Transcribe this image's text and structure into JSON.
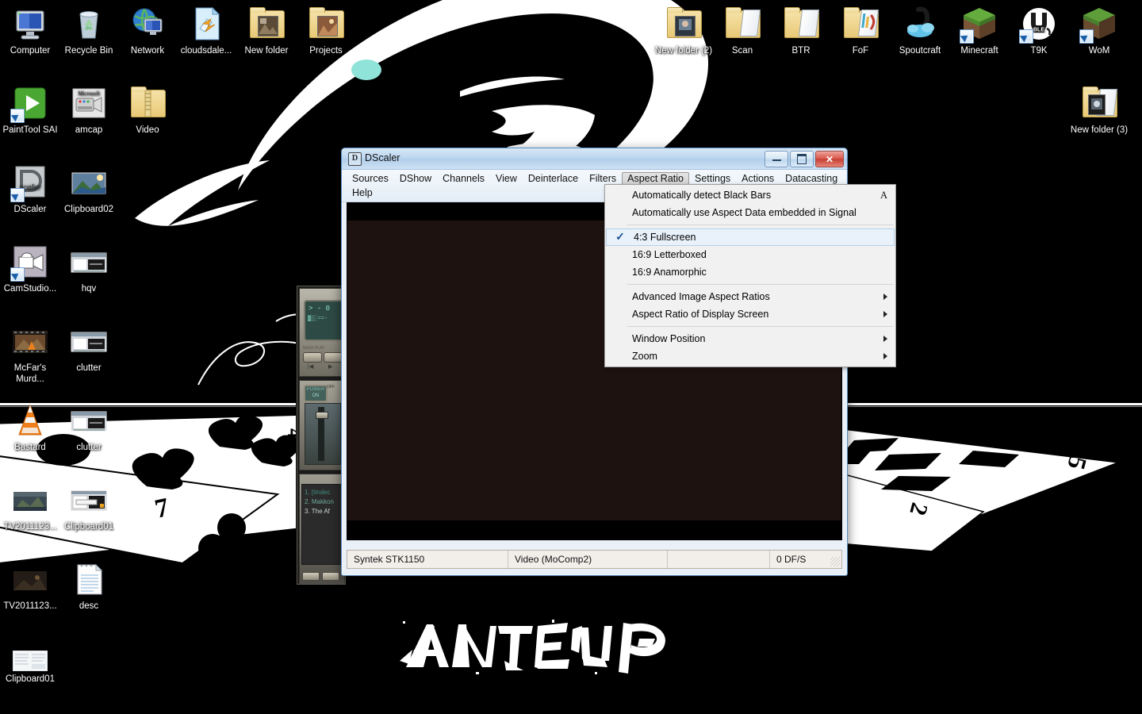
{
  "desktop": {
    "wallpaper_title": "ANTE UP",
    "background_color": "#000000",
    "accent_color": "#8fe3d8",
    "icons_row1": [
      {
        "label": "Computer",
        "icon": "computer-icon",
        "type": "computer"
      },
      {
        "label": "Recycle Bin",
        "icon": "recycle-bin-icon",
        "type": "recycle"
      },
      {
        "label": "Network",
        "icon": "network-icon",
        "type": "network"
      },
      {
        "label": "cloudsdale...",
        "icon": "file-icon",
        "type": "doc"
      },
      {
        "label": "New folder",
        "icon": "folder-icon",
        "type": "folder-pic"
      },
      {
        "label": "Projects",
        "icon": "folder-icon",
        "type": "folder-pic"
      }
    ],
    "icons_row2": [
      {
        "label": "PaintTool SAI",
        "icon": "painttool-sai-icon",
        "type": "sai"
      },
      {
        "label": "amcap",
        "icon": "amcap-icon",
        "type": "amcap"
      },
      {
        "label": "Video",
        "icon": "zip-folder-icon",
        "type": "zip"
      }
    ],
    "icons_left": [
      {
        "label": "DScaler",
        "icon": "dscaler-icon",
        "type": "dscaler"
      },
      {
        "label": "Clipboard02",
        "icon": "image-thumb-icon",
        "type": "thumb-land"
      },
      {
        "label": "CamStudio...",
        "icon": "camstudio-icon",
        "type": "camstudio"
      },
      {
        "label": "hqv",
        "icon": "image-thumb-icon",
        "type": "thumb-ui"
      },
      {
        "label": "McFar's Murd...",
        "icon": "video-thumb-icon",
        "type": "thumb-film"
      },
      {
        "label": "clutter",
        "icon": "image-thumb-icon",
        "type": "thumb-ui"
      },
      {
        "label": "Bastard",
        "icon": "vlc-icon",
        "type": "vlc"
      },
      {
        "label": "clutter",
        "icon": "image-thumb-icon",
        "type": "thumb-ui"
      },
      {
        "label": "TV2011123...",
        "icon": "image-thumb-icon",
        "type": "thumb-land"
      },
      {
        "label": "Clipboard01",
        "icon": "image-thumb-icon",
        "type": "thumb-ui"
      },
      {
        "label": "TV2011123...",
        "icon": "image-thumb-icon",
        "type": "thumb-dark"
      },
      {
        "label": "desc",
        "icon": "text-document-icon",
        "type": "doc"
      },
      {
        "label": "Clipboard01",
        "icon": "image-thumb-icon",
        "type": "thumb-ui"
      }
    ],
    "icons_right": [
      {
        "label": "New folder (2)",
        "icon": "folder-icon",
        "type": "folder-pic"
      },
      {
        "label": "Scan",
        "icon": "folder-icon",
        "type": "folder-open"
      },
      {
        "label": "BTR",
        "icon": "folder-icon",
        "type": "folder-open"
      },
      {
        "label": "FoF",
        "icon": "folder-icon",
        "type": "folder-pic2"
      },
      {
        "label": "Spoutcraft",
        "icon": "spoutcraft-icon",
        "type": "spout"
      },
      {
        "label": "Minecraft",
        "icon": "minecraft-icon",
        "type": "grassblock"
      },
      {
        "label": "T9K",
        "icon": "technic-icon",
        "type": "technic"
      },
      {
        "label": "WoM",
        "icon": "wom-icon",
        "type": "grassblock"
      },
      {
        "label": "New folder (3)",
        "icon": "folder-icon",
        "type": "folder-pic"
      }
    ]
  },
  "dscaler": {
    "title": "DScaler",
    "title_icon": "D",
    "window_buttons": {
      "minimize": "minimize-button",
      "maximize": "maximize-button",
      "close": "✕"
    },
    "menus_row1": [
      "Sources",
      "DShow",
      "Channels",
      "View",
      "Deinterlace",
      "Filters",
      "Aspect Ratio",
      "Settings",
      "Actions",
      "Datacasting"
    ],
    "menus_row2": [
      "Help"
    ],
    "active_menu": "Aspect Ratio",
    "video_background": "#1e1210",
    "statusbar": {
      "device": "Syntek STK1150",
      "mode": "Video (MoComp2)",
      "spare": "",
      "dropped": "0 DF/S"
    }
  },
  "aspect_menu": {
    "items": [
      {
        "label": "Automatically detect Black Bars",
        "accel": "A",
        "checked": false,
        "submenu": false,
        "separator_after": false
      },
      {
        "label": "Automatically use Aspect Data embedded in Signal",
        "accel": "",
        "checked": false,
        "submenu": false,
        "separator_after": true
      },
      {
        "label": "4:3 Fullscreen",
        "accel": "",
        "checked": true,
        "submenu": false,
        "separator_after": false
      },
      {
        "label": "16:9 Letterboxed",
        "accel": "",
        "checked": false,
        "submenu": false,
        "separator_after": false
      },
      {
        "label": "16:9 Anamorphic",
        "accel": "",
        "checked": false,
        "submenu": false,
        "separator_after": true
      },
      {
        "label": "Advanced Image Aspect Ratios",
        "accel": "",
        "checked": false,
        "submenu": true,
        "separator_after": false
      },
      {
        "label": "Aspect Ratio of Display Screen",
        "accel": "",
        "checked": false,
        "submenu": true,
        "separator_after": true
      },
      {
        "label": "Window Position",
        "accel": "",
        "checked": false,
        "submenu": true,
        "separator_after": false
      },
      {
        "label": "Zoom",
        "accel": "",
        "checked": false,
        "submenu": true,
        "separator_after": false
      }
    ],
    "check_glyph": "✓"
  },
  "player": {
    "display_text": "> - 0",
    "power_label_on": "ON",
    "power_label_off": "OFF",
    "transport_prev": "|◀",
    "transport_next": "▶",
    "playlist": [
      "1. [tindec",
      "2. Makkon",
      "3. The Af"
    ]
  }
}
